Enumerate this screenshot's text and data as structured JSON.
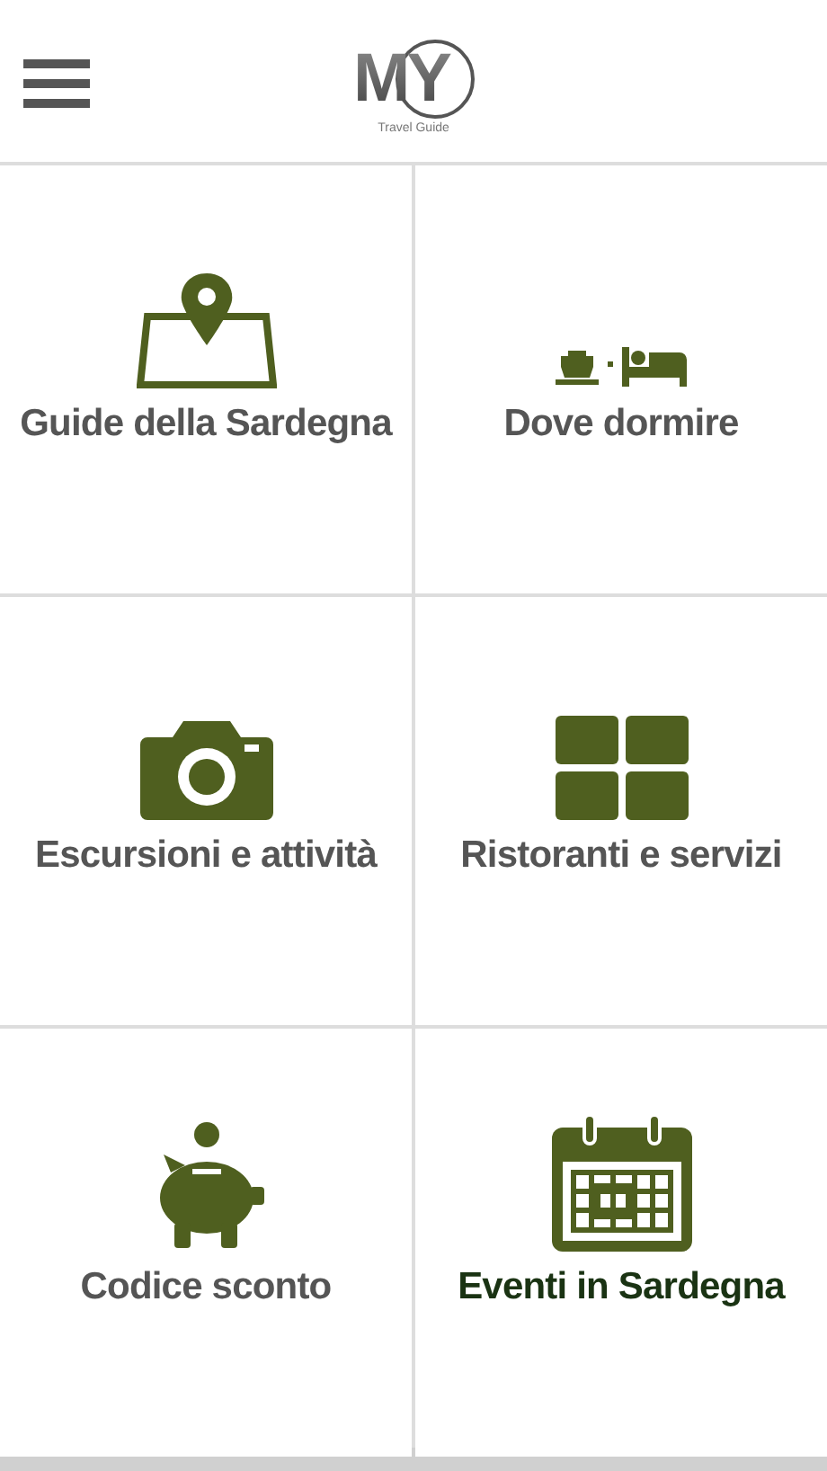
{
  "header": {
    "logo": {
      "letters": "MY",
      "tagline": "Travel Guide"
    }
  },
  "tiles": [
    {
      "label": "Guide della Sardegna",
      "kind": "map",
      "selected": false
    },
    {
      "label": "Dove dormire",
      "kind": "lodging",
      "selected": false
    },
    {
      "label": "Escursioni e attività",
      "kind": "camera",
      "selected": false
    },
    {
      "label": "Ristoranti e servizi",
      "kind": "grid",
      "selected": false
    },
    {
      "label": "Codice sconto",
      "kind": "piggy",
      "selected": false
    },
    {
      "label": "Eventi in Sardegna",
      "kind": "calendar",
      "selected": true
    }
  ]
}
